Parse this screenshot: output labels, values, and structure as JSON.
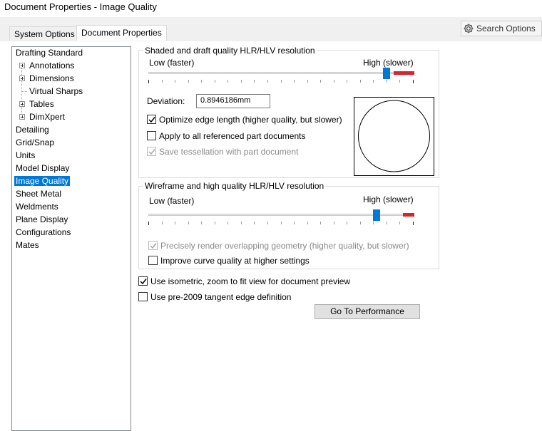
{
  "window": {
    "title": "Document Properties - Image Quality"
  },
  "tabs": [
    {
      "label": "System Options",
      "active": false
    },
    {
      "label": "Document Properties",
      "active": true
    }
  ],
  "search": {
    "label": "Search Options",
    "icon": "gear-icon"
  },
  "tree": {
    "items": [
      {
        "label": "Drafting Standard"
      },
      {
        "label": "Annotations",
        "expandable": true
      },
      {
        "label": "Dimensions",
        "expandable": true
      },
      {
        "label": "Virtual Sharps"
      },
      {
        "label": "Tables",
        "expandable": true
      },
      {
        "label": "DimXpert",
        "expandable": true
      },
      {
        "label": "Detailing"
      },
      {
        "label": "Grid/Snap"
      },
      {
        "label": "Units"
      },
      {
        "label": "Model Display"
      },
      {
        "label": "Image Quality",
        "selected": true
      },
      {
        "label": "Sheet Metal"
      },
      {
        "label": "Weldments"
      },
      {
        "label": "Plane Display"
      },
      {
        "label": "Configurations"
      },
      {
        "label": "Mates"
      }
    ]
  },
  "shaded": {
    "title": "Shaded and draft quality HLR/HLV resolution",
    "low_label": "Low (faster)",
    "high_label": "High (slower)",
    "slider_value": 0.91,
    "deviation_label": "Deviation:",
    "deviation_value": "0.8946186mm",
    "optimize_edge_label": "Optimize edge length (higher quality, but slower)",
    "optimize_edge_checked": true,
    "apply_all_label": "Apply to all referenced part documents",
    "apply_all_checked": false,
    "save_tess_label": "Save tessellation with part document",
    "save_tess_checked": true,
    "save_tess_disabled": true
  },
  "wireframe": {
    "title": "Wireframe and high quality HLR/HLV resolution",
    "low_label": "Low (faster)",
    "high_label": "High (slower)",
    "slider_value": 0.87,
    "precise_label": "Precisely render overlapping geometry (higher quality, but slower)",
    "precise_checked": true,
    "precise_disabled": true,
    "improve_curve_label": "Improve curve quality at higher settings",
    "improve_curve_checked": false
  },
  "options": {
    "isometric_label": "Use isometric, zoom to fit view for document preview",
    "isometric_checked": true,
    "pre2009_label": "Use pre-2009 tangent edge definition",
    "pre2009_checked": false
  },
  "performance_button": {
    "label": "Go To Performance"
  }
}
